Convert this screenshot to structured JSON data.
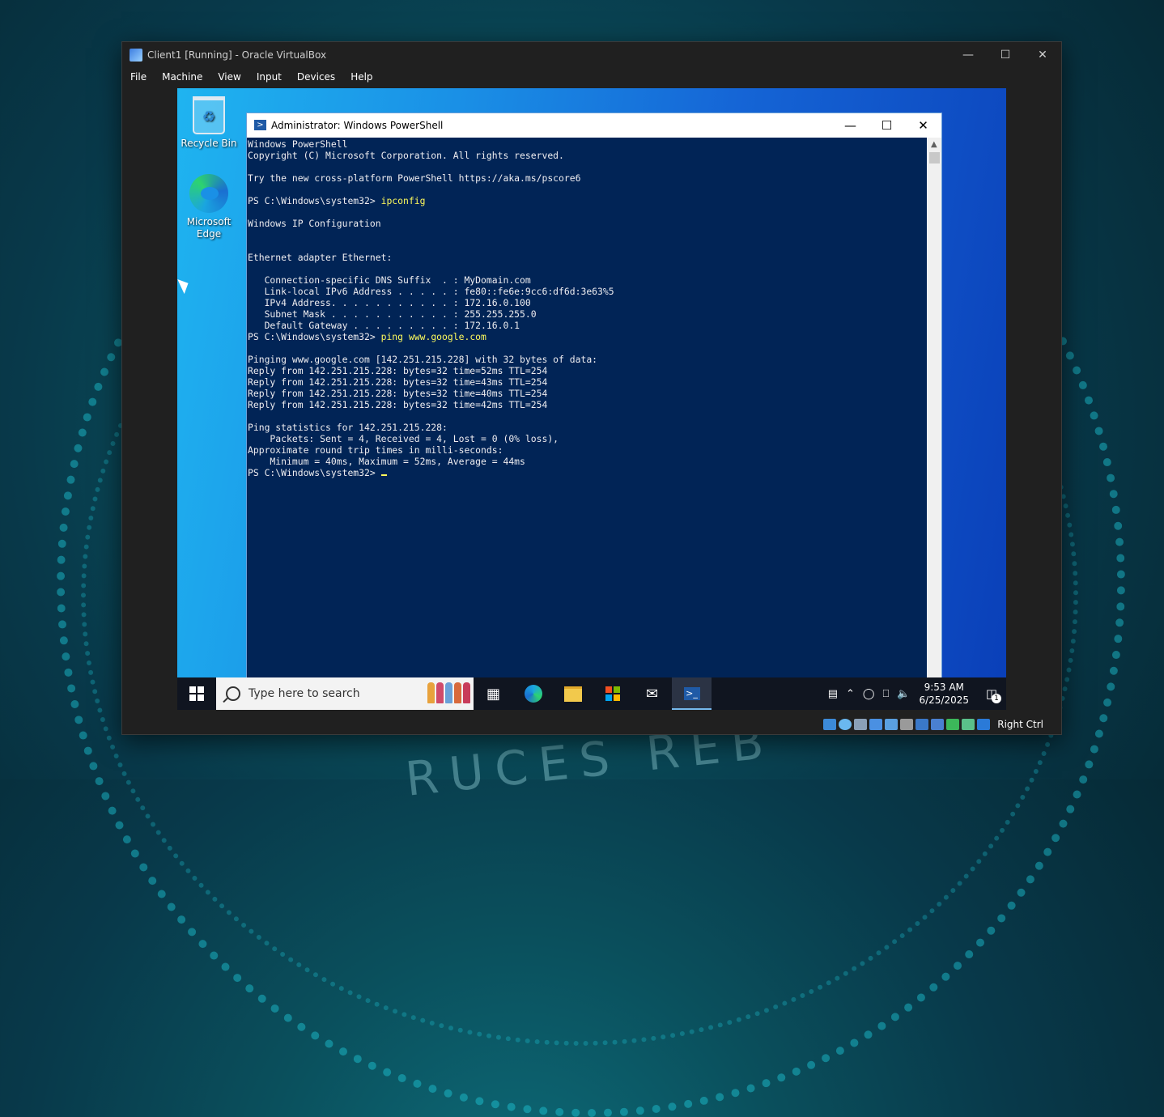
{
  "vbox": {
    "title": "Client1 [Running] - Oracle VirtualBox",
    "menu": [
      "File",
      "Machine",
      "View",
      "Input",
      "Devices",
      "Help"
    ],
    "host_key": "Right Ctrl"
  },
  "desktop": {
    "icons": [
      {
        "label": "Recycle Bin",
        "icon": "recycle-bin-icon"
      },
      {
        "label": "Microsoft Edge",
        "icon": "edge-icon"
      }
    ]
  },
  "powershell": {
    "title": "Administrator: Windows PowerShell",
    "prompt": "PS C:\\Windows\\system32> ",
    "cmd1": "ipconfig",
    "cmd2": "ping www.google.com",
    "out_header": "Windows PowerShell\nCopyright (C) Microsoft Corporation. All rights reserved.\n\nTry the new cross-platform PowerShell https://aka.ms/pscore6\n\n",
    "out_ipconfig": "\nWindows IP Configuration\n\n\nEthernet adapter Ethernet:\n\n   Connection-specific DNS Suffix  . : MyDomain.com\n   Link-local IPv6 Address . . . . . : fe80::fe6e:9cc6:df6d:3e63%5\n   IPv4 Address. . . . . . . . . . . : 172.16.0.100\n   Subnet Mask . . . . . . . . . . . : 255.255.255.0\n   Default Gateway . . . . . . . . . : 172.16.0.1\n",
    "out_ping": "\nPinging www.google.com [142.251.215.228] with 32 bytes of data:\nReply from 142.251.215.228: bytes=32 time=52ms TTL=254\nReply from 142.251.215.228: bytes=32 time=43ms TTL=254\nReply from 142.251.215.228: bytes=32 time=40ms TTL=254\nReply from 142.251.215.228: bytes=32 time=42ms TTL=254\n\nPing statistics for 142.251.215.228:\n    Packets: Sent = 4, Received = 4, Lost = 0 (0% loss),\nApproximate round trip times in milli-seconds:\n    Minimum = 40ms, Maximum = 52ms, Average = 44ms\n"
  },
  "taskbar": {
    "search_placeholder": "Type here to search",
    "apps": [
      "task-view-icon",
      "edge-icon",
      "file-explorer-icon",
      "store-icon",
      "mail-icon",
      "powershell-icon"
    ],
    "time": "9:53 AM",
    "date": "6/25/2025",
    "notification_count": "1"
  },
  "background_text": "CYBER SECURITY"
}
